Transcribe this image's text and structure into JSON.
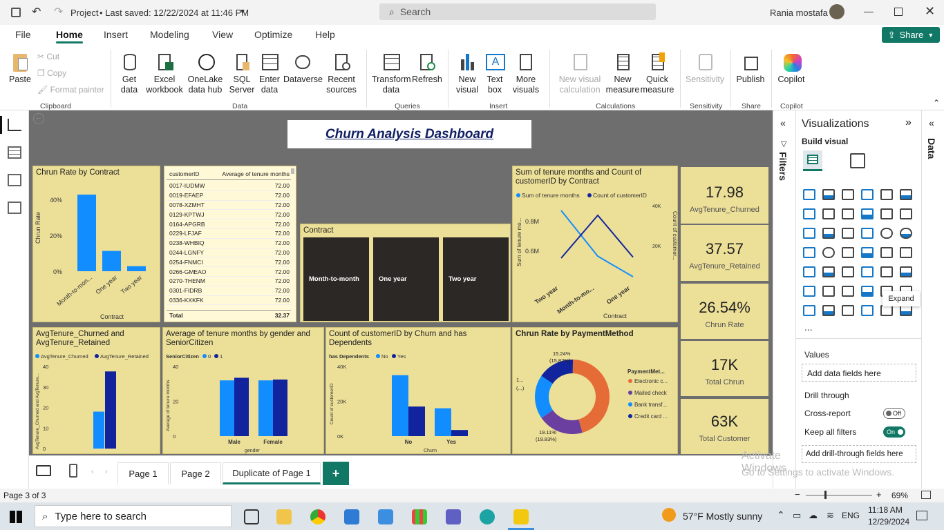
{
  "titlebar": {
    "project": "Project",
    "saved": "• Last saved: 12/22/2024 at 11:46 PM",
    "search_placeholder": "Search",
    "user": "Rania mostafa"
  },
  "menu": {
    "tabs": [
      "File",
      "Home",
      "Insert",
      "Modeling",
      "View",
      "Optimize",
      "Help"
    ],
    "share": "Share"
  },
  "ribbon": {
    "clipboard": {
      "paste": "Paste",
      "cut": "Cut",
      "copy": "Copy",
      "format_painter": "Format painter",
      "group": "Clipboard"
    },
    "data": {
      "get_data": "Get data",
      "excel": "Excel workbook",
      "onelake": "OneLake data hub",
      "sql": "SQL Server",
      "enter": "Enter data",
      "dataverse": "Dataverse",
      "recent": "Recent sources",
      "group": "Data"
    },
    "queries": {
      "transform": "Transform data",
      "refresh": "Refresh",
      "group": "Queries"
    },
    "insert": {
      "new_visual": "New visual",
      "text_box": "Text box",
      "more_visuals": "More visuals",
      "group": "Insert"
    },
    "calculations": {
      "new_visual_calc": "New visual calculation",
      "new_measure": "New measure",
      "quick_measure": "Quick measure",
      "group": "Calculations"
    },
    "sensitivity": {
      "label": "Sensitivity",
      "group": "Sensitivity"
    },
    "share": {
      "publish": "Publish",
      "group": "Share"
    },
    "copilot": {
      "label": "Copilot",
      "group": "Copilot"
    }
  },
  "dashboard": {
    "title": "Churn Analysis Dashboard",
    "churn_by_contract": {
      "title": "Chrun Rate by Contract",
      "ylabel": "Chrun Rate",
      "xlabel": "Contract",
      "yticks": [
        "40%",
        "20%",
        "0%"
      ],
      "chart_data": {
        "type": "bar",
        "categories": [
          "Month-to-mon...",
          "One year",
          "Two year"
        ],
        "values": [
          42.7,
          11.3,
          2.8
        ],
        "ylim": [
          0,
          45
        ]
      }
    },
    "tenure_table": {
      "headers": [
        "customerID",
        "Average of tenure months"
      ],
      "rows": [
        [
          "0017-IUDMW",
          "72.00"
        ],
        [
          "0019-EFAEP",
          "72.00"
        ],
        [
          "0078-XZMHT",
          "72.00"
        ],
        [
          "0129-KPTWJ",
          "72.00"
        ],
        [
          "0164-APGRB",
          "72.00"
        ],
        [
          "0229-LFJAF",
          "72.00"
        ],
        [
          "0238-WHBIQ",
          "72.00"
        ],
        [
          "0244-LGNFY",
          "72.00"
        ],
        [
          "0254-FNMCI",
          "72.00"
        ],
        [
          "0266-GMEAO",
          "72.00"
        ],
        [
          "0270-THENM",
          "72.00"
        ],
        [
          "0301-FIDRB",
          "72.00"
        ],
        [
          "0336-KXKFK",
          "72.00"
        ]
      ],
      "total_label": "Total",
      "total_value": "32.37"
    },
    "contract_slicer": {
      "title": "Contract",
      "options": [
        "Month-to-month",
        "One year",
        "Two year"
      ]
    },
    "sum_count_contract": {
      "title": "Sum of tenure months and Count of customerID by Contract",
      "legend": [
        "Sum of tenure months",
        "Count of customerID"
      ],
      "y1label": "Sum of tenure mo...",
      "y2label": "Count of customer...",
      "xlabel": "Contract",
      "y1ticks": [
        "0.8M",
        "0.6M"
      ],
      "y2ticks": [
        "40K",
        "20K"
      ],
      "chart_data": {
        "type": "line",
        "categories": [
          "Two year",
          "Month-to-mo...",
          "One year"
        ],
        "series": [
          {
            "name": "Sum of tenure months",
            "values": [
              0.92,
              0.63,
              0.5
            ]
          },
          {
            "name": "Count of customerID",
            "values": [
              13000,
              35000,
              13500
            ]
          }
        ]
      }
    },
    "cards": [
      {
        "value": "17.98",
        "label": "AvgTenure_Churned"
      },
      {
        "value": "37.57",
        "label": "AvgTenure_Retained"
      },
      {
        "value": "26.54%",
        "label": "Chrun Rate"
      },
      {
        "value": "17K",
        "label": "Total Chrun"
      },
      {
        "value": "63K",
        "label": "Total Customer"
      }
    ],
    "avg_tenure": {
      "title": "AvgTenure_Churned and AvgTenure_Retained",
      "legend": [
        "AvgTenure_Churned",
        "AvgTenure_Retained"
      ],
      "ylabel": "AvgTenure_Churned and AvgTenure...",
      "yticks": [
        "40",
        "30",
        "20",
        "10",
        "0"
      ],
      "chart_data": {
        "type": "bar",
        "series": [
          {
            "name": "AvgTenure_Churned",
            "values": [
              17.98
            ]
          },
          {
            "name": "AvgTenure_Retained",
            "values": [
              37.57
            ]
          }
        ],
        "ylim": [
          0,
          40
        ]
      }
    },
    "gender_senior": {
      "title": "Average of tenure months by gender and SeniorCitizen",
      "legend_title": "SeniorCitizen",
      "legend": [
        "0",
        "1"
      ],
      "ylabel": "Average of tenure months",
      "xlabel": "gender",
      "yticks": [
        "40",
        "20",
        "0"
      ],
      "chart_data": {
        "type": "bar",
        "categories": [
          "Male",
          "Female"
        ],
        "series": [
          {
            "name": "0",
            "values": [
              32,
              32
            ]
          },
          {
            "name": "1",
            "values": [
              33.5,
              32.5
            ]
          }
        ],
        "ylim": [
          0,
          40
        ]
      }
    },
    "churn_dependents": {
      "title": "Count of customerID by Churn and has Dependents",
      "legend_title": "has Dependents",
      "legend": [
        "No",
        "Yes"
      ],
      "ylabel": "Count of customerID",
      "xlabel": "Churn",
      "yticks": [
        "40K",
        "20K",
        "0K"
      ],
      "chart_data": {
        "type": "bar",
        "categories": [
          "No",
          "Yes"
        ],
        "series": [
          {
            "name": "No",
            "values": [
              35000,
              16000
            ]
          },
          {
            "name": "Yes",
            "values": [
              17000,
              3500
            ]
          }
        ],
        "ylim": [
          0,
          40000
        ]
      }
    },
    "payment": {
      "title": "Chrun Rate by PaymentMethod",
      "legend_title": "PaymentMet...",
      "legend": [
        "Electronic c...",
        "Mailed check",
        "Bank transf...",
        "Credit card ..."
      ],
      "labels": {
        "a": "15.24%",
        "a2": "(15.82%)",
        "b": "1...",
        "b2": "(...)",
        "c": "19.11%",
        "c2": "(19.83%)"
      },
      "chart_data": {
        "type": "pie",
        "categories": [
          "Electronic c...",
          "Mailed check",
          "Bank transf...",
          "Credit card ..."
        ],
        "values": [
          45.3,
          19.83,
          19.11,
          15.82
        ]
      }
    }
  },
  "filters": {
    "label": "Filters"
  },
  "viz": {
    "title": "Visualizations",
    "build": "Build visual",
    "values": "Values",
    "add_data": "Add data fields here",
    "drill": "Drill through",
    "cross": "Cross-report",
    "cross_state": "Off",
    "keep": "Keep all filters",
    "keep_state": "On",
    "add_drill": "Add drill-through fields here",
    "tooltip": "Expand",
    "more": "..."
  },
  "data_pane": {
    "label": "Data"
  },
  "pages": {
    "tabs": [
      "Page 1",
      "Page 2",
      "Duplicate of Page 1"
    ],
    "add": "+"
  },
  "status": {
    "page": "Page 3 of 3",
    "zoom": "69%",
    "activate": "Activate Windows",
    "activate2": "Go to Settings to activate Windows."
  },
  "taskbar": {
    "search": "Type here to search",
    "weather": "57°F  Mostly sunny",
    "lang": "ENG",
    "time": "11:18 AM",
    "date": "12/29/2024"
  },
  "colors": {
    "accent": "#117865",
    "tile": "#ecdf98",
    "light_blue": "#118dff",
    "dark_blue": "#12239e",
    "orange": "#e66c37",
    "purple": "#6b007b"
  }
}
